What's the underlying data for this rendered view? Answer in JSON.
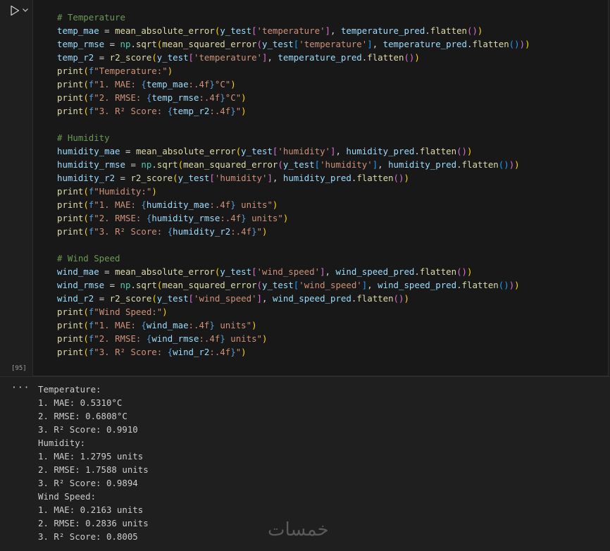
{
  "cell": {
    "execution_count": "[95]",
    "run_icon": "play-icon",
    "collapse_icon": "chevron-down-icon"
  },
  "code_lines": [
    "# Temperature",
    "temp_mae = mean_absolute_error(y_test['temperature'], temperature_pred.flatten())",
    "temp_rmse = np.sqrt(mean_squared_error(y_test['temperature'], temperature_pred.flatten()))",
    "temp_r2 = r2_score(y_test['temperature'], temperature_pred.flatten())",
    "print(f\"Temperature:\")",
    "print(f\"1. MAE: {temp_mae:.4f}°C\")",
    "print(f\"2. RMSE: {temp_rmse:.4f}°C\")",
    "print(f\"3. R² Score: {temp_r2:.4f}\")",
    "",
    "# Humidity",
    "humidity_mae = mean_absolute_error(y_test['humidity'], humidity_pred.flatten())",
    "humidity_rmse = np.sqrt(mean_squared_error(y_test['humidity'], humidity_pred.flatten()))",
    "humidity_r2 = r2_score(y_test['humidity'], humidity_pred.flatten())",
    "print(f\"Humidity:\")",
    "print(f\"1. MAE: {humidity_mae:.4f} units\")",
    "print(f\"2. RMSE: {humidity_rmse:.4f} units\")",
    "print(f\"3. R² Score: {humidity_r2:.4f}\")",
    "",
    "# Wind Speed",
    "wind_mae = mean_absolute_error(y_test['wind_speed'], wind_speed_pred.flatten())",
    "wind_rmse = np.sqrt(mean_squared_error(y_test['wind_speed'], wind_speed_pred.flatten()))",
    "wind_r2 = r2_score(y_test['wind_speed'], wind_speed_pred.flatten())",
    "print(f\"Wind Speed:\")",
    "print(f\"1. MAE: {wind_mae:.4f} units\")",
    "print(f\"2. RMSE: {wind_rmse:.4f} units\")",
    "print(f\"3. R² Score: {wind_r2:.4f}\")"
  ],
  "output": {
    "more_icon": "ellipsis-icon",
    "more_label": "···",
    "lines": [
      "Temperature:",
      "1. MAE: 0.5310°C",
      "2. RMSE: 0.6808°C",
      "3. R² Score: 0.9910",
      "Humidity:",
      "1. MAE: 1.2795 units",
      "2. RMSE: 1.7588 units",
      "3. R² Score: 0.9894",
      "Wind Speed:",
      "1. MAE: 0.2163 units",
      "2. RMSE: 0.2836 units",
      "3. R² Score: 0.8005"
    ]
  },
  "watermark": "خمسات",
  "colors": {
    "background": "#1f1f1f",
    "cell_background": "#181818",
    "comment": "#6a9955",
    "identifier": "#9cdcfe",
    "function": "#dcdcaa",
    "string": "#ce9178",
    "module": "#4ec9b0",
    "bracket_level1": "#ffd700",
    "bracket_level2": "#da70d6",
    "bracket_level3": "#179fff"
  }
}
